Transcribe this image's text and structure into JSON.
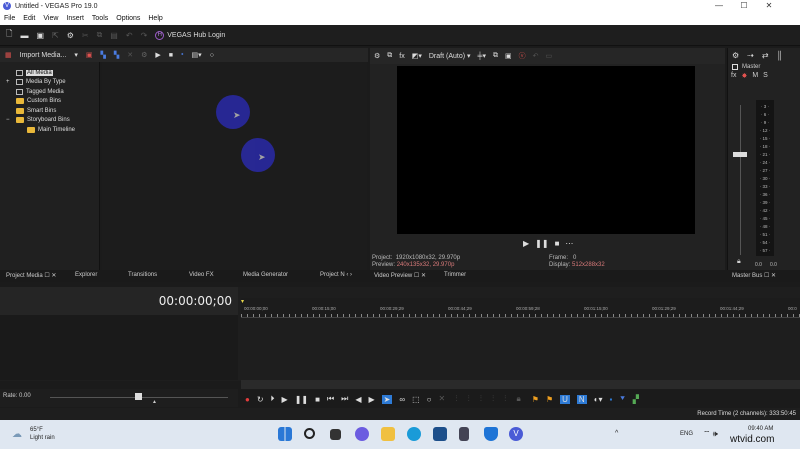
{
  "titlebar": {
    "title": "Untitled - VEGAS Pro 19.0",
    "logo": "V",
    "minimize": "—",
    "maximize": "☐",
    "close": "✕"
  },
  "menu": [
    "File",
    "Edit",
    "View",
    "Insert",
    "Tools",
    "Options",
    "Help"
  ],
  "toolbar": {
    "hub_label": "VEGAS Hub Login",
    "hub_icon": "H"
  },
  "media_toolbar": {
    "import_label": "Import Media..."
  },
  "tree": [
    {
      "label": "All Media",
      "type": "media",
      "selected": true
    },
    {
      "label": "Media By Type",
      "type": "media",
      "expand": "+"
    },
    {
      "label": "Tagged Media",
      "type": "media"
    },
    {
      "label": "Custom Bins",
      "type": "folder"
    },
    {
      "label": "Smart Bins",
      "type": "folder"
    },
    {
      "label": "Storyboard Bins",
      "type": "folder",
      "expand": "−"
    },
    {
      "label": "Main Timeline",
      "type": "folder",
      "indent": true
    }
  ],
  "preview": {
    "quality": "Draft (Auto)",
    "project_label": "Project:",
    "project_value": "1920x1080x32, 29.970p",
    "preview_label": "Preview:",
    "preview_value": "240x135x32, 29.970p",
    "frame_label": "Frame:",
    "frame_value": "0",
    "display_label": "Display:",
    "display_value": "512x288x32"
  },
  "master": {
    "title": "Master",
    "fx": "fx",
    "m": "M",
    "s": "S",
    "scale": [
      "3",
      "6",
      "9",
      "12",
      "15",
      "18",
      "21",
      "24",
      "27",
      "30",
      "33",
      "36",
      "39",
      "42",
      "45",
      "48",
      "51",
      "54",
      "57"
    ],
    "left_peak": "0.0",
    "right_peak": "0.0"
  },
  "tabs": [
    {
      "label": "Project Media ☐ ✕"
    },
    {
      "label": "Explorer"
    },
    {
      "label": "Transitions"
    },
    {
      "label": "Video FX"
    },
    {
      "label": "Media Generator"
    },
    {
      "label": "Project N ‹ ›"
    },
    {
      "label": "Video Preview ☐ ✕"
    },
    {
      "label": "Trimmer"
    },
    {
      "label": "Master Bus ☐ ✕"
    }
  ],
  "timeline": {
    "timecode": "00:00:00;00",
    "ruler": [
      "00:00:00;00",
      "00:00:15;00",
      "00:00:29;29",
      "00:00:44;29",
      "00:00:59;28",
      "00:01:15;00",
      "00:01:29;29",
      "00:01:44;29",
      "00:0"
    ],
    "rate": "Rate: 0.00"
  },
  "status": {
    "record_time": "Record Time (2 channels): 333:50:45"
  },
  "taskbar": {
    "temp": "65°F",
    "weather": "Light rain",
    "lang": "ENG",
    "time": "09:40 AM",
    "watermark": "wtvid.com"
  },
  "colors": {
    "accent": "#2e7bd6",
    "record": "#e33c3c",
    "folder": "#e9b83a"
  }
}
